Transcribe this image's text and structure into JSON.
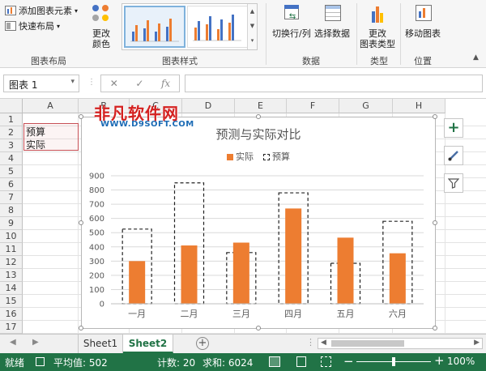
{
  "ribbon": {
    "add_element": "添加图表元素",
    "quick_layout": "快速布局",
    "change_colors": "更改\n颜色",
    "switch_row_col": "切换行/列",
    "select_data": "选择数据",
    "change_type": "更改\n图表类型",
    "move_chart": "移动图表",
    "groups": {
      "layout": "图表布局",
      "styles": "图表样式",
      "data": "数据",
      "type": "类型",
      "location": "位置"
    }
  },
  "formula_bar": {
    "name_box": "图表 1",
    "fx": "fx"
  },
  "columns": [
    "A",
    "B",
    "C",
    "D",
    "E",
    "F",
    "G",
    "H"
  ],
  "rows": [
    "1",
    "2",
    "3",
    "4",
    "5",
    "6",
    "7",
    "8",
    "9",
    "10",
    "11",
    "12",
    "13",
    "14",
    "15",
    "16",
    "17"
  ],
  "cells": {
    "a2": "预算",
    "a3": "实际"
  },
  "watermark": {
    "main": "非凡软件网",
    "sub": "WWW.D9SOFT.COM"
  },
  "chart_data": {
    "type": "bar",
    "title": "预测与实际对比",
    "categories": [
      "一月",
      "二月",
      "三月",
      "四月",
      "五月",
      "六月"
    ],
    "series": [
      {
        "name": "实际",
        "values": [
          300,
          410,
          430,
          670,
          465,
          355
        ],
        "color": "#ed7d31"
      },
      {
        "name": "预算",
        "values": [
          525,
          850,
          360,
          780,
          285,
          580
        ],
        "color": "#ffffff"
      }
    ],
    "ylim": [
      0,
      900
    ],
    "yticks": [
      "0",
      "100",
      "200",
      "300",
      "400",
      "500",
      "600",
      "700",
      "800",
      "900"
    ],
    "grid": true,
    "legend": "top"
  },
  "sheets": [
    "Sheet1",
    "Sheet2"
  ],
  "active_sheet": "Sheet2",
  "status": {
    "ready": "就绪",
    "average": "平均值: 502",
    "count": "计数: 20",
    "sum": "求和: 6024",
    "zoom": "100%"
  },
  "colors": {
    "accent": "#217346",
    "bar": "#ed7d31"
  }
}
